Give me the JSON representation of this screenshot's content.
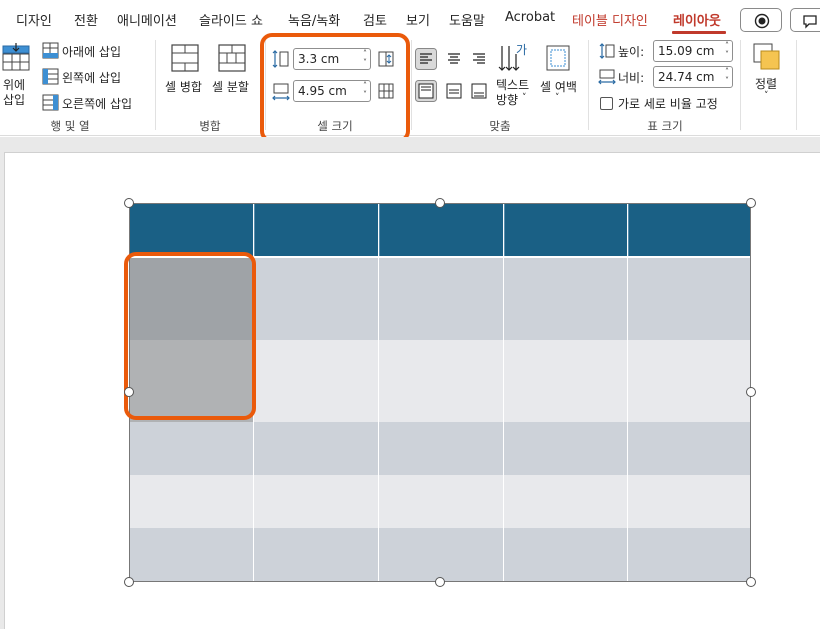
{
  "tabs": [
    {
      "label": "디자인"
    },
    {
      "label": "전환"
    },
    {
      "label": "애니메이션"
    },
    {
      "label": "슬라이드 쇼"
    },
    {
      "label": "녹음/녹화"
    },
    {
      "label": "검토"
    },
    {
      "label": "보기"
    },
    {
      "label": "도움말"
    },
    {
      "label": "Acrobat"
    },
    {
      "label": "테이블 디자인"
    },
    {
      "label": "레이아웃"
    }
  ],
  "active_tab": "레이아웃",
  "ribbon": {
    "rows_cols": {
      "insert_above": "위에\n삽입",
      "insert_below": "아래에 삽입",
      "insert_left": "왼쪽에 삽입",
      "insert_right": "오른쪽에 삽입",
      "group_label": "행 및 열"
    },
    "merge": {
      "merge_cells": "셀 병합",
      "split_cells": "셀 분할",
      "group_label": "병합"
    },
    "cell_size": {
      "height_value": "3.3 cm",
      "width_value": "4.95 cm",
      "group_label": "셀 크기"
    },
    "alignment": {
      "text_direction": "텍스트\n방향",
      "cell_margins": "셀 여백",
      "group_label": "맞춤"
    },
    "table_size": {
      "height_label": "높이:",
      "height_value": "15.09 cm",
      "width_label": "너비:",
      "width_value": "24.74 cm",
      "lock_aspect_label": "가로 세로 비율 고정",
      "group_label": "표 크기"
    },
    "arrange": {
      "label": "정렬"
    }
  },
  "colors": {
    "accent": "#c0392b",
    "highlight": "#ea5a0b",
    "table_header": "#1a6085",
    "row_dark": "#cdd2d9",
    "row_light": "#e8e9ec",
    "selected_cell": "#a5a8ab"
  }
}
